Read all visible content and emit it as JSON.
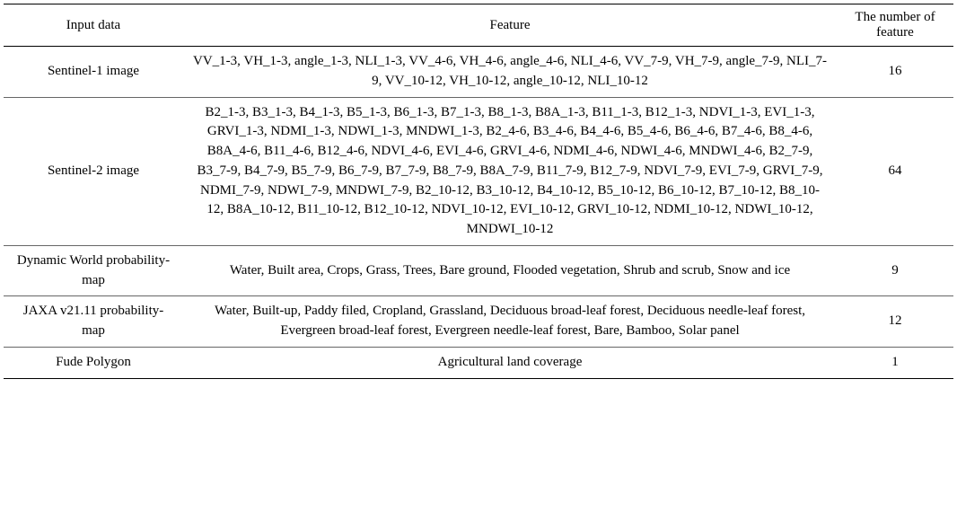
{
  "chart_data": {
    "type": "table",
    "headers": {
      "input": "Input data",
      "feature": "Feature",
      "count": "The number of feature"
    },
    "rows": [
      {
        "input": "Sentinel-1 image",
        "feature": "VV_1-3, VH_1-3, angle_1-3, NLI_1-3, VV_4-6, VH_4-6, angle_4-6, NLI_4-6, VV_7-9, VH_7-9, angle_7-9, NLI_7-9, VV_10-12, VH_10-12, angle_10-12, NLI_10-12",
        "count": "16"
      },
      {
        "input": "Sentinel-2 image",
        "feature": "B2_1-3, B3_1-3, B4_1-3, B5_1-3, B6_1-3, B7_1-3, B8_1-3, B8A_1-3, B11_1-3, B12_1-3, NDVI_1-3, EVI_1-3, GRVI_1-3, NDMI_1-3, NDWI_1-3, MNDWI_1-3, B2_4-6, B3_4-6, B4_4-6, B5_4-6, B6_4-6, B7_4-6, B8_4-6, B8A_4-6, B11_4-6, B12_4-6, NDVI_4-6, EVI_4-6, GRVI_4-6, NDMI_4-6, NDWI_4-6, MNDWI_4-6, B2_7-9, B3_7-9, B4_7-9, B5_7-9, B6_7-9, B7_7-9, B8_7-9, B8A_7-9, B11_7-9, B12_7-9, NDVI_7-9, EVI_7-9, GRVI_7-9, NDMI_7-9, NDWI_7-9, MNDWI_7-9, B2_10-12, B3_10-12, B4_10-12, B5_10-12, B6_10-12, B7_10-12, B8_10-12, B8A_10-12, B11_10-12, B12_10-12, NDVI_10-12, EVI_10-12, GRVI_10-12, NDMI_10-12, NDWI_10-12, MNDWI_10-12",
        "count": "64"
      },
      {
        "input": "Dynamic World probability-map",
        "feature": "Water, Built area, Crops, Grass, Trees, Bare ground, Flooded vegetation, Shrub and scrub, Snow and ice",
        "count": "9"
      },
      {
        "input": "JAXA v21.11 probability-map",
        "feature": "Water, Built-up, Paddy filed, Cropland, Grassland, Deciduous broad-leaf forest, Deciduous needle-leaf forest, Evergreen broad-leaf forest, Evergreen needle-leaf forest, Bare, Bamboo, Solar panel",
        "count": "12"
      },
      {
        "input": "Fude Polygon",
        "feature": "Agricultural land coverage",
        "count": "1"
      }
    ]
  }
}
